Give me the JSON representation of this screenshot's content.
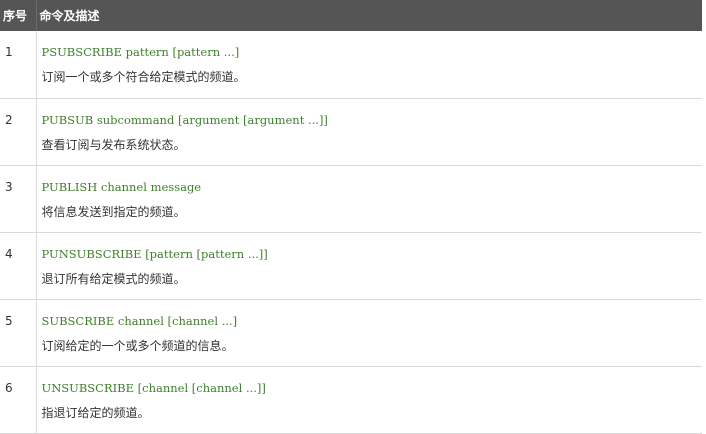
{
  "header": {
    "index_label": "序号",
    "desc_label": "命令及描述"
  },
  "rows": [
    {
      "index": "1",
      "command": "PSUBSCRIBE pattern [pattern ...]",
      "description": "订阅一个或多个符合给定模式的频道。"
    },
    {
      "index": "2",
      "command": "PUBSUB subcommand [argument [argument ...]]",
      "description": "查看订阅与发布系统状态。"
    },
    {
      "index": "3",
      "command": "PUBLISH channel message",
      "description": "将信息发送到指定的频道。"
    },
    {
      "index": "4",
      "command": "PUNSUBSCRIBE [pattern [pattern ...]]",
      "description": "退订所有给定模式的频道。"
    },
    {
      "index": "5",
      "command": "SUBSCRIBE channel [channel ...]",
      "description": "订阅给定的一个或多个频道的信息。"
    },
    {
      "index": "6",
      "command": "UNSUBSCRIBE [channel [channel ...]]",
      "description": "指退订给定的频道。"
    }
  ],
  "colors": {
    "header_bg": "#555555",
    "command_text": "#3e7f2d",
    "body_text": "#333333",
    "row_border": "#d9d9d9"
  }
}
